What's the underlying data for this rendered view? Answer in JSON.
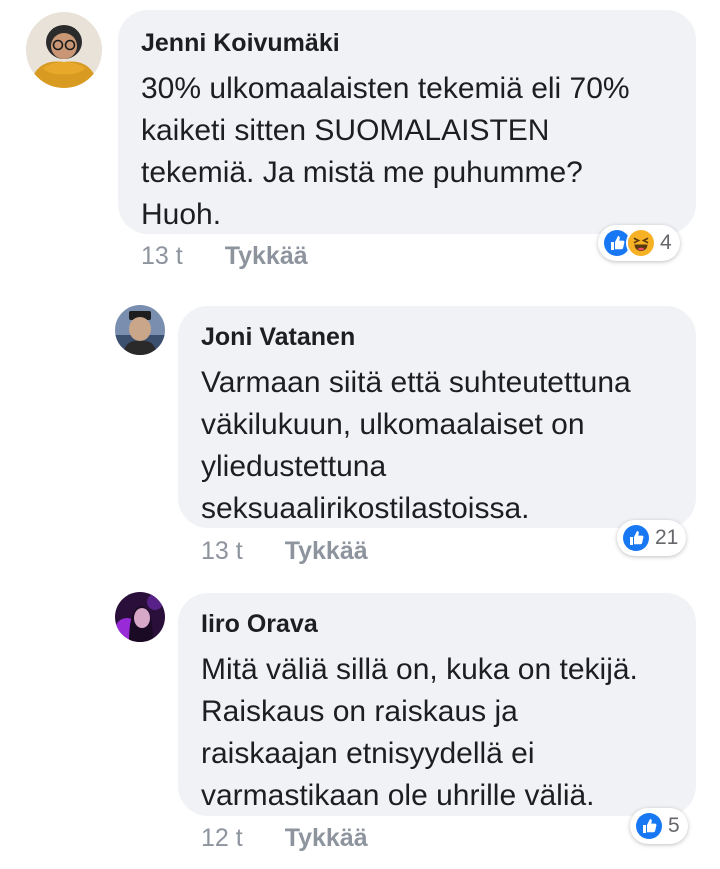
{
  "comments": [
    {
      "author": "Jenni Koivumäki",
      "text": "30% ulkomaalaisten tekemiä eli 70%\nkaiketi sitten SUOMALAISTEN\ntekemiä. Ja mistä me puhumme?\nHuoh.",
      "time": "13 t",
      "like_label": "Tykkää",
      "reactions": [
        "like-icon",
        "haha-icon"
      ],
      "reaction_count": "4"
    },
    {
      "author": "Joni Vatanen",
      "text": "Varmaan siitä että suhteutettuna\nväkilukuun, ulkomaalaiset on\nyliedustettuna\nseksuaalirikostilastoissa.",
      "time": "13 t",
      "like_label": "Tykkää",
      "reactions": [
        "like-icon"
      ],
      "reaction_count": "21"
    },
    {
      "author": "Iiro Orava",
      "text": "Mitä väliä sillä on, kuka on tekijä.\nRaiskaus on raiskaus ja\nraiskaajan etnisyydellä ei\nvarmastikaan ole uhrille väliä.",
      "time": "12 t",
      "like_label": "Tykkää",
      "reactions": [
        "like-icon"
      ],
      "reaction_count": "5"
    }
  ],
  "colors": {
    "bubble": "#f0f2f5",
    "meta_text": "#8d949e",
    "like_blue": "#1877f2",
    "haha_yellow": "#f7b125"
  }
}
